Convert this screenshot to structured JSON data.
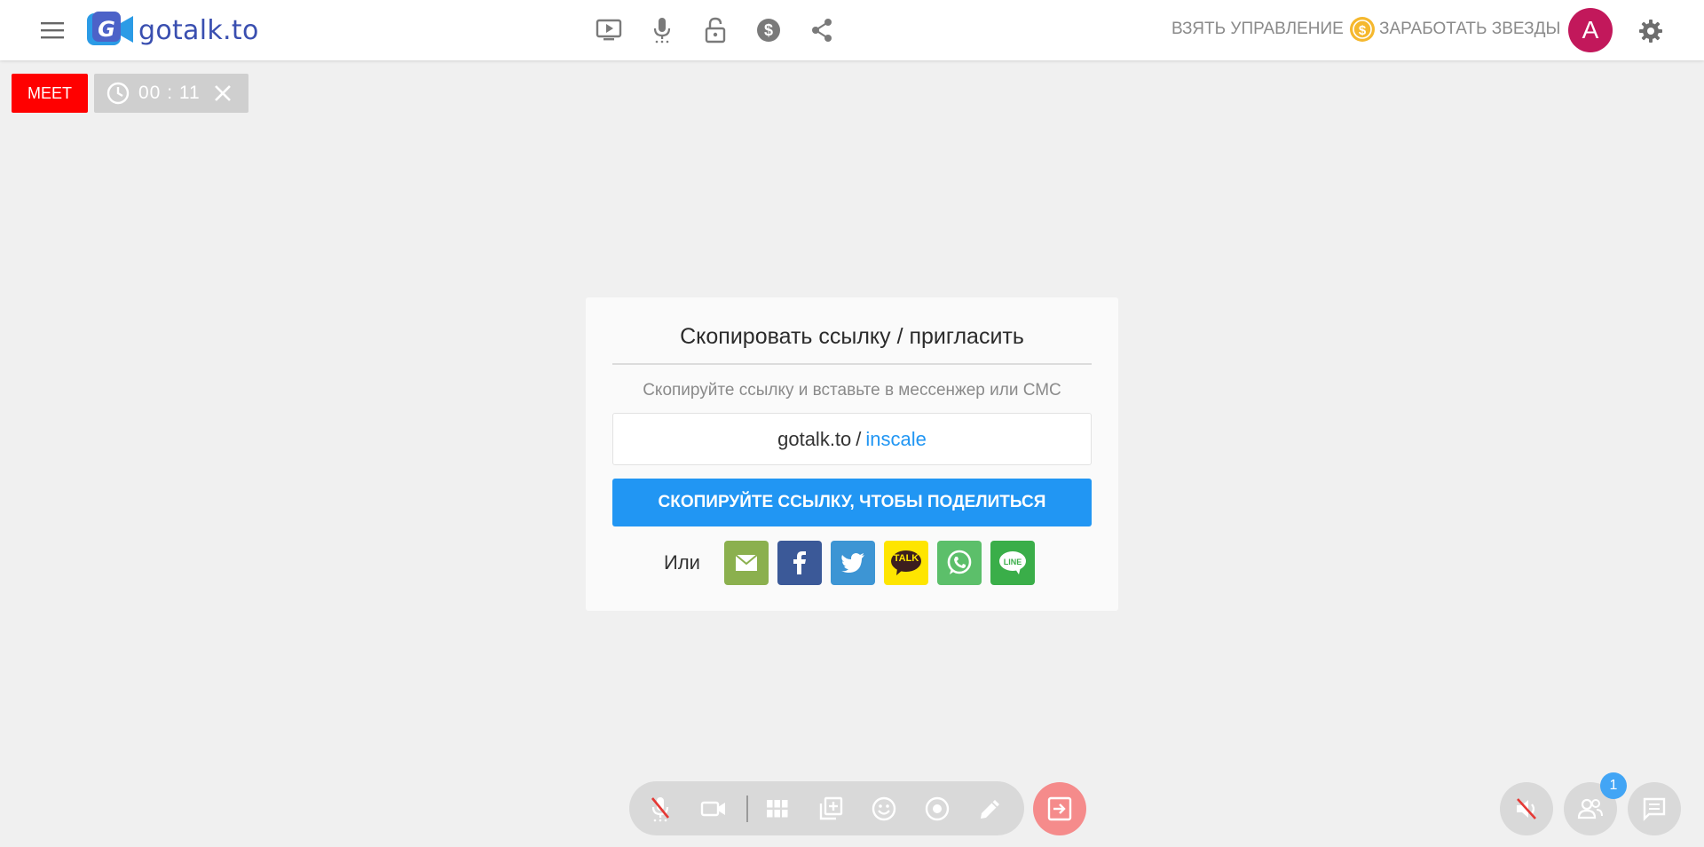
{
  "app": {
    "logo_text": "gotalk.to"
  },
  "header": {
    "icons": [
      "play-screen-icon",
      "microphone-icon",
      "lock-open-icon",
      "dollar-icon",
      "share-icon"
    ],
    "take_control": "ВЗЯТЬ УПРАВЛЕНИЕ",
    "earn_stars": "ЗАРАБОТАТЬ ЗВЕЗДЫ",
    "avatar_letter": "A",
    "colors": {
      "avatar": "#c2185b",
      "coin": "#f5b82e"
    }
  },
  "session": {
    "badge": "MEET",
    "timer": "00 : 11"
  },
  "invite": {
    "title": "Скопировать ссылку / пригласить",
    "subtitle": "Скопируйте ссылку и вставьте в мессенжер или СМС",
    "link_domain": "gotalk.to",
    "link_separator": "/",
    "link_room": "inscale",
    "copy_button": "СКОПИРУЙТЕ ССЫЛКУ, ЧТОБЫ ПОДЕЛИТЬСЯ",
    "or_label": "Или",
    "share": [
      {
        "name": "email",
        "color": "#8bb04e"
      },
      {
        "name": "facebook",
        "color": "#3b5998"
      },
      {
        "name": "twitter",
        "color": "#3d95d4"
      },
      {
        "name": "kakaotalk",
        "color": "#fee500",
        "label": "TALK"
      },
      {
        "name": "whatsapp",
        "color": "#5cbf6a"
      },
      {
        "name": "line",
        "color": "#3aae49",
        "label": "LINE"
      }
    ]
  },
  "toolbar": {
    "buttons": [
      "mic-muted-icon",
      "camera-icon",
      "grid-layout-icon",
      "add-window-icon",
      "emoji-icon",
      "record-icon",
      "pencil-icon"
    ],
    "exit": "exit-icon"
  },
  "corner": {
    "participants_count": "1"
  }
}
